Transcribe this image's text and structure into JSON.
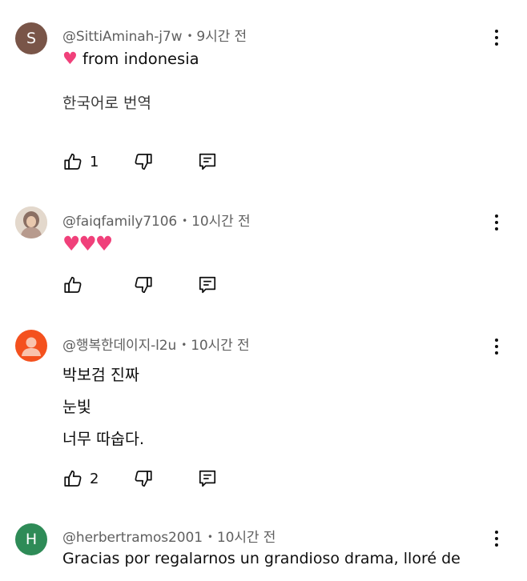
{
  "comments": [
    {
      "avatar_letter": "S",
      "avatar_color": "#795548",
      "author": "@SittiAminah-j7w",
      "time": "9시간 전",
      "lines": [
        "from indonesia"
      ],
      "emoji_prefix": "♥",
      "translate": "한국어로 번역",
      "likes": "1"
    },
    {
      "author": "@faiqfamily7106",
      "time": "10시간 전",
      "emoji_line": "♥♥♥",
      "likes": ""
    },
    {
      "author": "@행복한데이지-l2u",
      "time": "10시간 전",
      "lines": [
        "박보검  진짜",
        "눈빛",
        "너무 따숩다."
      ],
      "likes": "2"
    },
    {
      "avatar_letter": "H",
      "avatar_color": "#2e8b57",
      "author": "@herbertramos2001",
      "time": "10시간 전",
      "lines": [
        "Gracias por regalarnos un grandioso drama, lloré de"
      ]
    }
  ],
  "separator": "•",
  "colors": {
    "text": "#0f0f0f",
    "meta": "#606060",
    "default_avatar": "#f4511e"
  },
  "icons": [
    "like-icon",
    "dislike-icon",
    "reply-icon",
    "more-vert-icon"
  ]
}
